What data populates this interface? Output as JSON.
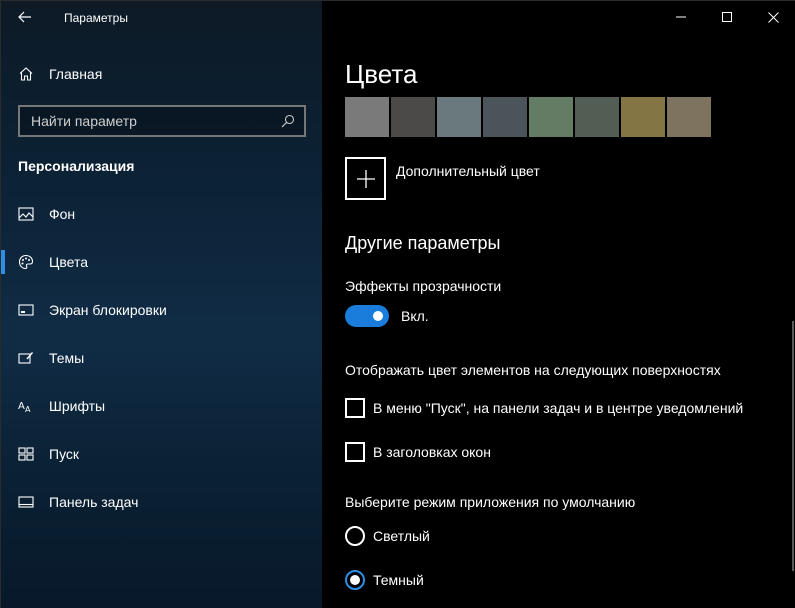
{
  "app": {
    "title": "Параметры"
  },
  "nav": {
    "home_label": "Главная",
    "search_placeholder": "Найти параметр",
    "section_title": "Персонализация",
    "items": [
      {
        "label": "Фон",
        "icon": "picture-icon",
        "active": false
      },
      {
        "label": "Цвета",
        "icon": "palette-icon",
        "active": true
      },
      {
        "label": "Экран блокировки",
        "icon": "lock-screen-icon",
        "active": false
      },
      {
        "label": "Темы",
        "icon": "themes-icon",
        "active": false
      },
      {
        "label": "Шрифты",
        "icon": "fonts-icon",
        "active": false
      },
      {
        "label": "Пуск",
        "icon": "start-icon",
        "active": false
      },
      {
        "label": "Панель задач",
        "icon": "taskbar-icon",
        "active": false
      }
    ]
  },
  "main": {
    "title": "Цвета",
    "swatches": [
      "#7a7a7a",
      "#4c4a48",
      "#69797e",
      "#4a5459",
      "#647c64",
      "#525e54",
      "#847545",
      "#7e735f"
    ],
    "custom_color_label": "Дополнительный цвет",
    "other_title": "Другие параметры",
    "transparency_label": "Эффекты прозрачности",
    "transparency_state": "Вкл.",
    "transparency_on": true,
    "accent_surfaces_label": "Отображать цвет элементов на следующих поверхностях",
    "surface_start": "В меню \"Пуск\", на панели задач и в центре уведомлений",
    "surface_titlebars": "В заголовках окон",
    "app_mode_label": "Выберите режим приложения по умолчанию",
    "mode_light": "Светлый",
    "mode_dark": "Темный",
    "mode_selected": "dark"
  },
  "colors": {
    "accent": "#1a7ddb"
  }
}
